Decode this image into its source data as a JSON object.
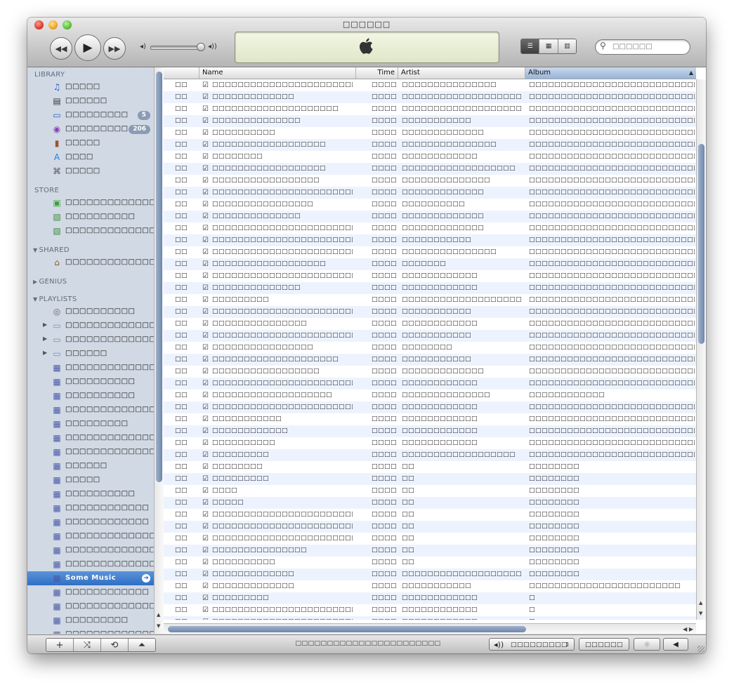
{
  "window": {
    "title": "□□□□□□"
  },
  "search": {
    "placeholder": "□□□□□□"
  },
  "sidebar": {
    "sections": {
      "library": "LIBRARY",
      "store": "STORE",
      "shared": "SHARED",
      "genius": "GENIUS",
      "playlists": "PLAYLISTS"
    },
    "library": [
      {
        "label": "□□□□□",
        "icon": "music-note-icon"
      },
      {
        "label": "□□□□□□",
        "icon": "film-icon"
      },
      {
        "label": "□□□□□□□□□",
        "icon": "tv-icon",
        "badge": "5"
      },
      {
        "label": "□□□□□□□□□",
        "icon": "podcast-icon",
        "badge": "206"
      },
      {
        "label": "□□□□□",
        "icon": "book-icon"
      },
      {
        "label": "□□□□",
        "icon": "app-store-icon"
      },
      {
        "label": "□□□□□",
        "icon": "radio-icon"
      }
    ],
    "store": [
      {
        "label": "□□□□□□□□□□□□□",
        "icon": "store-icon"
      },
      {
        "label": "□□□□□□□□□□",
        "icon": "purchased-icon"
      },
      {
        "label": "□□□□□□□□□□□□□□□□",
        "icon": "purchased-icon"
      }
    ],
    "shared": [
      {
        "label": "□□□□□□□□□□□□□",
        "icon": "home-icon"
      }
    ],
    "playlists": [
      {
        "label": "□□□□□□□□□□",
        "icon": "party-shuffle-icon",
        "folder": false
      },
      {
        "label": "□□□□□□□□□□□□□□",
        "icon": "folder-icon",
        "folder": true
      },
      {
        "label": "□□□□□□□□□□□□□□□",
        "icon": "folder-icon",
        "folder": true
      },
      {
        "label": "□□□□□□",
        "icon": "folder-icon",
        "folder": true
      },
      {
        "label": "□□□□□□□□□□□□□□□",
        "icon": "playlist-icon",
        "folder": false
      },
      {
        "label": "□□□□□□□□□□",
        "icon": "playlist-icon",
        "folder": false
      },
      {
        "label": "□□□□□□□□□□",
        "icon": "playlist-icon",
        "folder": false
      },
      {
        "label": "□□□□□□□□□□□□□□",
        "icon": "playlist-icon",
        "folder": false
      },
      {
        "label": "□□□□□□□□□",
        "icon": "playlist-icon",
        "folder": false
      },
      {
        "label": "□□□□□□□□□□□□□□□",
        "icon": "playlist-icon",
        "folder": false
      },
      {
        "label": "□□□□□□□□□□□□□□□",
        "icon": "playlist-icon",
        "folder": false
      },
      {
        "label": "□□□□□□",
        "icon": "playlist-icon",
        "folder": false
      },
      {
        "label": "□□□□□",
        "icon": "playlist-icon",
        "folder": false
      },
      {
        "label": "□□□□□□□□□□",
        "icon": "playlist-icon",
        "folder": false
      },
      {
        "label": "□□□□□□□□□□□□",
        "icon": "playlist-icon",
        "folder": false
      },
      {
        "label": "□□□□□□□□□□□□",
        "icon": "playlist-icon",
        "folder": false
      },
      {
        "label": "□□□□□□□□□□□□□",
        "icon": "playlist-icon",
        "folder": false
      },
      {
        "label": "□□□□□□□□□□□□□□□",
        "icon": "playlist-icon",
        "folder": false
      },
      {
        "label": "□□□□□□□□□□□□□□□",
        "icon": "playlist-icon",
        "folder": false
      },
      {
        "label": "Some Music",
        "icon": "playlist-icon",
        "folder": false,
        "selected": true
      },
      {
        "label": "□□□□□□□□□□□□",
        "icon": "playlist-icon",
        "folder": false
      },
      {
        "label": "□□□□□□□□□□□□□□□",
        "icon": "playlist-icon",
        "folder": false
      },
      {
        "label": "□□□□□□□□□",
        "icon": "playlist-icon",
        "folder": false
      },
      {
        "label": "□□□□□□□□□□□□□",
        "icon": "playlist-icon",
        "folder": false
      }
    ]
  },
  "table": {
    "columns": {
      "name": "Name",
      "time": "Time",
      "artist": "Artist",
      "album": "Album"
    },
    "rows": [
      {
        "num": "□□",
        "name": "□□□□□□□□□□□□□□□□□□□□□□□□□□",
        "time": "□□□□",
        "artist": "□□□□□□□□□□□□□□□",
        "album": "□□□□□□□□□□□□□□□□□□□□□□□□□□□□□□"
      },
      {
        "num": "□□",
        "name": "□□□□□□□□□□□□□",
        "time": "□□□□",
        "artist": "□□□□□□□□□□□□□□□□□□□",
        "album": "□□□□□□□□□□□□□□□□□□□□□□□□□□□□□□"
      },
      {
        "num": "□□",
        "name": "□□□□□□□□□□□□□□□□□□□□",
        "time": "□□□□",
        "artist": "□□□□□□□□□□□□□□□□□□□□□",
        "album": "□□□□□□□□□□□□□□□□□□□□□□□□□□□□□□"
      },
      {
        "num": "□□",
        "name": "□□□□□□□□□□□□□□",
        "time": "□□□□",
        "artist": "□□□□□□□□□□□",
        "album": "□□□□□□□□□□□□□□□□□□□□□□□□□□□□□□"
      },
      {
        "num": "□□",
        "name": "□□□□□□□□□□",
        "time": "□□□□",
        "artist": "□□□□□□□□□□□□□",
        "album": "□□□□□□□□□□□□□□□□□□□□□□□□□□□□□□"
      },
      {
        "num": "□□",
        "name": "□□□□□□□□□□□□□□□□□□",
        "time": "□□□□",
        "artist": "□□□□□□□□□□□□□□□",
        "album": "□□□□□□□□□□□□□□□□□□□□□□□□□□□□□□"
      },
      {
        "num": "□□",
        "name": "□□□□□□□□",
        "time": "□□□□",
        "artist": "□□□□□□□□□□□□",
        "album": "□□□□□□□□□□□□□□□□□□□□□□□□□□□□□□"
      },
      {
        "num": "□□",
        "name": "□□□□□□□□□□□□□□□□□□",
        "time": "□□□□",
        "artist": "□□□□□□□□□□□□□□□□□□",
        "album": "□□□□□□□□□□□□□□□□□□□□□□□□□□□□□□"
      },
      {
        "num": "□□",
        "name": "□□□□□□□□□□□□□□□□□",
        "time": "□□□□",
        "artist": "□□□□□□□□□□□□□□",
        "album": "□□□□□□□□□□□□□□□□□□□□□□□□□□□□□□"
      },
      {
        "num": "□□",
        "name": "□□□□□□□□□□□□□□□□□□□□□□□□□□",
        "time": "□□□□",
        "artist": "□□□□□□□□□□□□□",
        "album": "□□□□□□□□□□□□□□□□□□□□□□□□□□□□□□"
      },
      {
        "num": "□□",
        "name": "□□□□□□□□□□□□□□□□",
        "time": "□□□□",
        "artist": "□□□□□□□□□□",
        "album": "□□□□□□□□□□□□□□□□□□□□□□□□□□□□□□"
      },
      {
        "num": "□□",
        "name": "□□□□□□□□□□□□□□",
        "time": "□□□□",
        "artist": "□□□□□□□□□□□□□",
        "album": "□□□□□□□□□□□□□□□□□□□□□□□□□□□□□□"
      },
      {
        "num": "□□",
        "name": "□□□□□□□□□□□□□□□□□□□□□□□□□□",
        "time": "□□□□",
        "artist": "□□□□□□□□□□□□□",
        "album": "□□□□□□□□□□□□□□□□□□□□□□□□□□□□□□"
      },
      {
        "num": "□□",
        "name": "□□□□□□□□□□□□□□□□□□□□□□□□□□",
        "time": "□□□□",
        "artist": "□□□□□□□□□□□",
        "album": "□□□□□□□□□□□□□□□□□□□□□□□□□□□□□□"
      },
      {
        "num": "□□",
        "name": "□□□□□□□□□□□□□□□□□□□□□□□",
        "time": "□□□□",
        "artist": "□□□□□□□□□□□□□□□",
        "album": "□□□□□□□□□□□□□□□□□□□□□□□□□□□□□□"
      },
      {
        "num": "□□",
        "name": "□□□□□□□□□□□□□□□□□□",
        "time": "□□□□",
        "artist": "□□□□□□□",
        "album": "□□□□□□□□□□□□□□□□□□□□□□□□□□□□□□"
      },
      {
        "num": "□□",
        "name": "□□□□□□□□□□□□□□□□□□□□□□□□□□",
        "time": "□□□□",
        "artist": "□□□□□□□□□□□□",
        "album": "□□□□□□□□□□□□□□□□□□□□□□□□□□□□□□"
      },
      {
        "num": "□□",
        "name": "□□□□□□□□□□□□□□",
        "time": "□□□□",
        "artist": "□□□□□□□□□□□□",
        "album": "□□□□□□□□□□□□□□□□□□□□□□□□□□□□□□"
      },
      {
        "num": "□□",
        "name": "□□□□□□□□□",
        "time": "□□□□",
        "artist": "□□□□□□□□□□□□□□□□□□□□□",
        "album": "□□□□□□□□□□□□□□□□□□□□□□□□□□□□□□"
      },
      {
        "num": "□□",
        "name": "□□□□□□□□□□□□□□□□□□□□□□□□□□",
        "time": "□□□□",
        "artist": "□□□□□□□□□□□",
        "album": "□□□□□□□□□□□□□□□□□□□□□□□□□□□□□□"
      },
      {
        "num": "□□",
        "name": "□□□□□□□□□□□□□□□",
        "time": "□□□□",
        "artist": "□□□□□□□□□□□□",
        "album": "□□□□□□□□□□□□□□□□□□□□□□□□□□□□□□"
      },
      {
        "num": "□□",
        "name": "□□□□□□□□□□□□□□□□□□□□□□□□□□",
        "time": "□□□□",
        "artist": "□□□□□□□□□□□",
        "album": "□□□□□□□□□□□□□□□□□□□□□□□□□□□□□□"
      },
      {
        "num": "□□",
        "name": "□□□□□□□□□□□□□□□□",
        "time": "□□□□",
        "artist": "□□□□□□□□",
        "album": "□□□□□□□□□□□□□□□□□□□□□□□□□□□□□□"
      },
      {
        "num": "□□",
        "name": "□□□□□□□□□□□□□□□□□□□□",
        "time": "□□□□",
        "artist": "□□□□□□□□□□□",
        "album": "□□□□□□□□□□□□□□□□□□□□□□□□□□□□□□"
      },
      {
        "num": "□□",
        "name": "□□□□□□□□□□□□□□□□□",
        "time": "□□□□",
        "artist": "□□□□□□□□□□□□□",
        "album": "□□□□□□□□□□□□□□□□□□□□□□□□□□□□□□"
      },
      {
        "num": "□□",
        "name": "□□□□□□□□□□□□□□□□□□□□□□□□□□",
        "time": "□□□□",
        "artist": "□□□□□□□□□□□□",
        "album": "□□□□□□□□□□□□□□□□□□□□□□□□□□□□□□"
      },
      {
        "num": "□□",
        "name": "□□□□□□□□□□□□□□□□□□□",
        "time": "□□□□",
        "artist": "□□□□□□□□□□□□□□",
        "album": "□□□□□□□□□□□□"
      },
      {
        "num": "□□",
        "name": "□□□□□□□□□□□□□□□□□□□□□□□□□□",
        "time": "□□□□",
        "artist": "□□□□□□□□□□□□",
        "album": "□□□□□□□□□□□□□□□□□□□□□□□□□□□□□"
      },
      {
        "num": "□□",
        "name": "□□□□□□□□□□□",
        "time": "□□□□",
        "artist": "□□□□□□□□□□□□",
        "album": "□□□□□□□□□□□□□□□□□□□□□□□□□□□□□"
      },
      {
        "num": "□□",
        "name": "□□□□□□□□□□□□",
        "time": "□□□□",
        "artist": "□□□□□□□□□□□□",
        "album": "□□□□□□□□□□□□□□□□□□□□□□□□□□□□□"
      },
      {
        "num": "□□",
        "name": "□□□□□□□□□□",
        "time": "□□□□",
        "artist": "□□□□□□□□□□□□",
        "album": "□□□□□□□□□□□□□□□□□□□□□□□□□□□□□"
      },
      {
        "num": "□□",
        "name": "□□□□□□□□□",
        "time": "□□□□",
        "artist": "□□□□□□□□□□□□□□□□□□",
        "album": "□□□□□□□□□□□□□□□□□□□□□□□□□□□□□□"
      },
      {
        "num": "□□",
        "name": "□□□□□□□□",
        "time": "□□□□",
        "artist": "□□",
        "album": "□□□□□□□□"
      },
      {
        "num": "□□",
        "name": "□□□□□□□□□",
        "time": "□□□□",
        "artist": "□□",
        "album": "□□□□□□□□"
      },
      {
        "num": "□□",
        "name": "□□□□",
        "time": "□□□□",
        "artist": "□□",
        "album": "□□□□□□□□"
      },
      {
        "num": "□□",
        "name": "□□□□□",
        "time": "□□□□",
        "artist": "□□",
        "album": "□□□□□□□□"
      },
      {
        "num": "□□",
        "name": "□□□□□□□□□□□□□□□□□□□□□□□□□□",
        "time": "□□□□",
        "artist": "□□",
        "album": "□□□□□□□□"
      },
      {
        "num": "□□",
        "name": "□□□□□□□□□□□□□□□□□□□□□□□□□□",
        "time": "□□□□",
        "artist": "□□",
        "album": "□□□□□□□□"
      },
      {
        "num": "□□",
        "name": "□□□□□□□□□□□□□□□□□□□□□□□□□□",
        "time": "□□□□",
        "artist": "□□",
        "album": "□□□□□□□□"
      },
      {
        "num": "□□",
        "name": "□□□□□□□□□□□□□□□",
        "time": "□□□□",
        "artist": "□□",
        "album": "□□□□□□□□"
      },
      {
        "num": "□□",
        "name": "□□□□□□□□□□",
        "time": "□□□□",
        "artist": "□□",
        "album": "□□□□□□□□"
      },
      {
        "num": "□□",
        "name": "□□□□□□□□□□□□□",
        "time": "□□□□",
        "artist": "□□□□□□□□□□□□□□□□□□□□□",
        "album": "□□□□□□□□"
      },
      {
        "num": "□□",
        "name": "□□□□□□□□□□□□□",
        "time": "□□□□",
        "artist": "□□□□□□□□□□□",
        "album": "□□□□□□□□□□□□□□□□□□□□□□□□"
      },
      {
        "num": "□□",
        "name": "□□□□□□□□□",
        "time": "□□□□",
        "artist": "□□□□□□□□□□□□",
        "album": "□"
      },
      {
        "num": "□□",
        "name": "□□□□□□□□□□□□□□□□□□□□□□□□",
        "time": "□□□□",
        "artist": "□□□□□□□□□□□□",
        "album": "□"
      },
      {
        "num": "□□",
        "name": "□□□□□□□□□□□□□□□□□□□□□□□□□□",
        "time": "□□□□",
        "artist": "□□□□□□□□□□□□",
        "album": "□"
      }
    ]
  },
  "bottombar": {
    "status": "□□□□□□□□□□□□□□□□□□□□□□□",
    "speakers": "□□□□□□□□□",
    "burn": "□□□□□□"
  }
}
